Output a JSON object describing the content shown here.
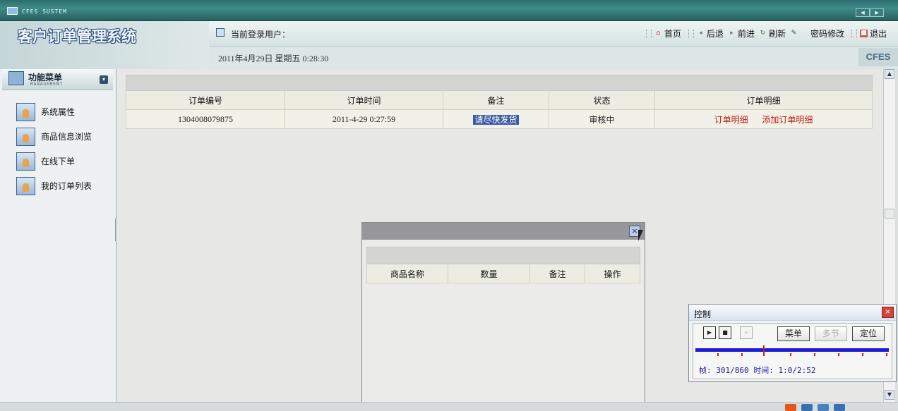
{
  "window": {
    "title": "CFES SUSTEM"
  },
  "header": {
    "app_title": "客户订单管理系统",
    "user_label": "当前登录用户：",
    "date_time": "2011年4月29日  星期五  0:28:30",
    "brand": "CFES",
    "links": [
      {
        "label": "首页",
        "icon": "home-icon"
      },
      {
        "label": "后退",
        "icon": "back-icon"
      },
      {
        "label": "前进",
        "icon": "forward-icon"
      },
      {
        "label": "刷新",
        "icon": "refresh-icon"
      },
      {
        "label": "密码修改",
        "icon": "password-edit-icon"
      },
      {
        "label": "退出",
        "icon": "logout-icon"
      }
    ]
  },
  "sidebar": {
    "title": "功能菜单",
    "subtitle": "MANAGEMENT",
    "items": [
      {
        "label": "系统属性",
        "icon": "user-card-icon"
      },
      {
        "label": "商品信息浏览",
        "icon": "user-card-icon"
      },
      {
        "label": "在线下单",
        "icon": "user-card-icon"
      },
      {
        "label": "我的订单列表",
        "icon": "user-card-icon"
      }
    ]
  },
  "orders_table": {
    "columns": [
      "订单编号",
      "订单时间",
      "备注",
      "状态",
      "订单明细"
    ],
    "rows": [
      {
        "order_no": "1304008079875",
        "order_time": "2011-4-29 0:27:59",
        "note": "请尽快发货",
        "status": "审核中",
        "detail_link": "订单明细",
        "add_detail_link": "添加订单明细"
      }
    ]
  },
  "detail_dialog": {
    "close_glyph": "×",
    "columns": [
      "商品名称",
      "数量",
      "备注",
      "操作"
    ]
  },
  "control_panel": {
    "title": "控制",
    "buttons": {
      "menu": "菜单",
      "multi": "多节",
      "locate": "定位"
    },
    "status": "帧: 301/860 时间: 1:0/2:52",
    "progress": 0.35
  },
  "colors": {
    "accent_teal": "#2c6f6f",
    "link_red": "#c41b12",
    "selection_blue": "#3a5ca6",
    "track_blue": "#1c1cd6"
  }
}
